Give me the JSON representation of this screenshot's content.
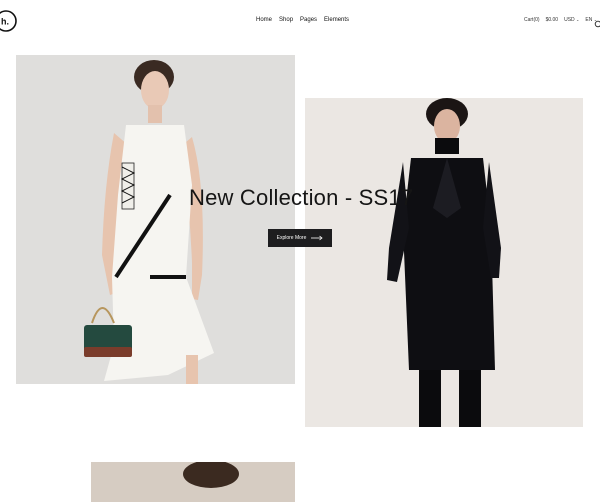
{
  "header": {
    "logo_text": "h.",
    "nav": [
      {
        "label": "Home"
      },
      {
        "label": "Shop"
      },
      {
        "label": "Pages"
      },
      {
        "label": "Elements"
      }
    ],
    "cart_label": "Cart(0)",
    "cart_total": "$0.00",
    "currency": "USD",
    "language": "EN"
  },
  "hero": {
    "title": "New Collection - SS17",
    "cta_label": "Explore More"
  },
  "icons": {
    "search": "search-icon",
    "arrow": "arrow-right-icon",
    "chevron": "chevron-down-icon"
  },
  "colors": {
    "background": "#ffffff",
    "button": "#1d1d1f",
    "text": "#151515"
  }
}
